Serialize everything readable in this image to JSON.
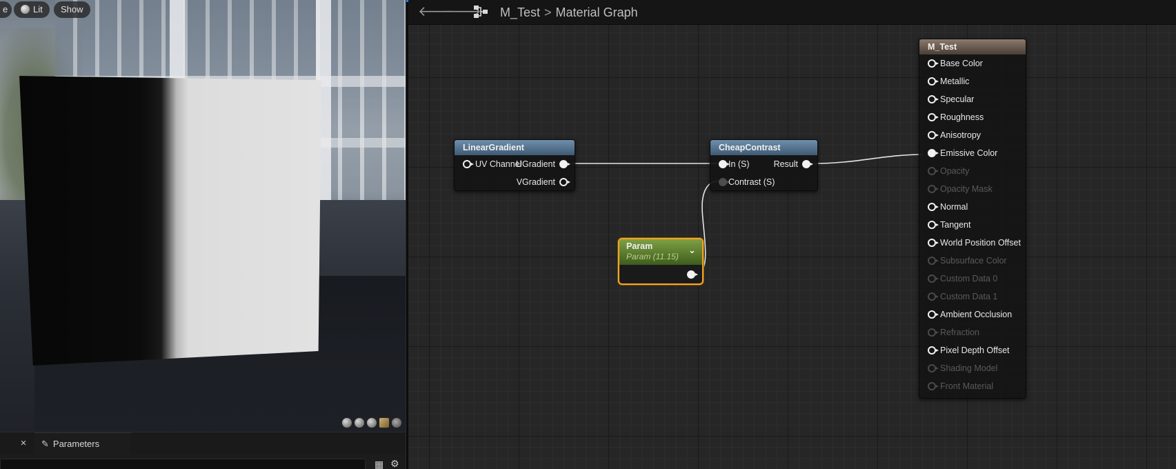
{
  "viewport": {
    "buttons": {
      "e": "e",
      "lit": "Lit",
      "show": "Show"
    },
    "preview_shapes": [
      "cylinder-icon",
      "sphere-icon",
      "plane-icon",
      "cube-icon",
      "teapot-icon"
    ]
  },
  "params_panel": {
    "close": "×",
    "tab_label": "Parameters",
    "search_placeholder": ""
  },
  "toolbar": {
    "crumb_asset": "M_Test",
    "crumb_sep": ">",
    "crumb_graph": "Material Graph"
  },
  "nodes": {
    "linear_gradient": {
      "title": "LinearGradient",
      "inputs": [
        "UV Channel"
      ],
      "outputs": [
        "UGradient",
        "VGradient"
      ]
    },
    "cheap_contrast": {
      "title": "CheapContrast",
      "inputs": [
        "In (S)",
        "Contrast (S)"
      ],
      "outputs": [
        "Result"
      ]
    },
    "param": {
      "title": "Param",
      "subtitle": "Param (11.15)"
    },
    "m_test": {
      "title": "M_Test",
      "pins": [
        {
          "label": "Base Color",
          "enabled": true
        },
        {
          "label": "Metallic",
          "enabled": true
        },
        {
          "label": "Specular",
          "enabled": true
        },
        {
          "label": "Roughness",
          "enabled": true
        },
        {
          "label": "Anisotropy",
          "enabled": true
        },
        {
          "label": "Emissive Color",
          "enabled": true,
          "connected": true
        },
        {
          "label": "Opacity",
          "enabled": false
        },
        {
          "label": "Opacity Mask",
          "enabled": false
        },
        {
          "label": "Normal",
          "enabled": true
        },
        {
          "label": "Tangent",
          "enabled": true
        },
        {
          "label": "World Position Offset",
          "enabled": true
        },
        {
          "label": "Subsurface Color",
          "enabled": false
        },
        {
          "label": "Custom Data 0",
          "enabled": false
        },
        {
          "label": "Custom Data 1",
          "enabled": false
        },
        {
          "label": "Ambient Occlusion",
          "enabled": true
        },
        {
          "label": "Refraction",
          "enabled": false
        },
        {
          "label": "Pixel Depth Offset",
          "enabled": true
        },
        {
          "label": "Shading Model",
          "enabled": false
        },
        {
          "label": "Front Material",
          "enabled": false
        }
      ]
    }
  },
  "colors": {
    "param_selected_border": "#f5a623",
    "wire": "#e6e6e6"
  }
}
